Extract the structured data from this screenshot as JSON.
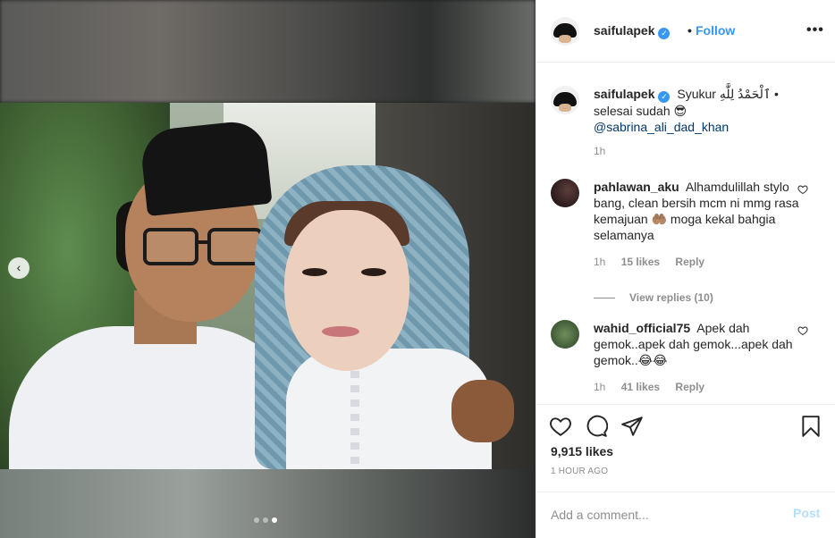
{
  "header": {
    "username": "saifulapek",
    "separator": "•",
    "follow_label": "Follow",
    "more_label": "•••"
  },
  "media": {
    "prev_arrow": "‹",
    "carousel_dots": 3,
    "active_dot": 3
  },
  "caption": {
    "username": "saifulapek",
    "text": "Syukur ٱلْحَمْدُ لِلَّٰهِ • selesai sudah 😎",
    "mention": "@sabrina_ali_dad_khan",
    "time": "1h"
  },
  "comments": [
    {
      "username": "pahlawan_aku",
      "text": "Alhamdulillah stylo bang, clean bersih mcm ni mmg rasa kemajuan 🤲🏽 moga kekal bahgia selamanya",
      "time": "1h",
      "likes": "15 likes",
      "reply_label": "Reply",
      "view_replies": "View replies (10)"
    },
    {
      "username": "wahid_official75",
      "text": "Apek dah gemok..apek dah gemok...apek dah gemok..😂😂",
      "time": "1h",
      "likes": "41 likes",
      "reply_label": "Reply"
    }
  ],
  "actions": {
    "likes_count": "9,915 likes",
    "timestamp": "1 HOUR AGO"
  },
  "add_comment": {
    "placeholder": "Add a comment...",
    "post_label": "Post"
  },
  "colors": {
    "accent": "#3897f0",
    "post_disabled": "#b2dffc",
    "muted": "#8e8e8e",
    "text": "#262626"
  }
}
